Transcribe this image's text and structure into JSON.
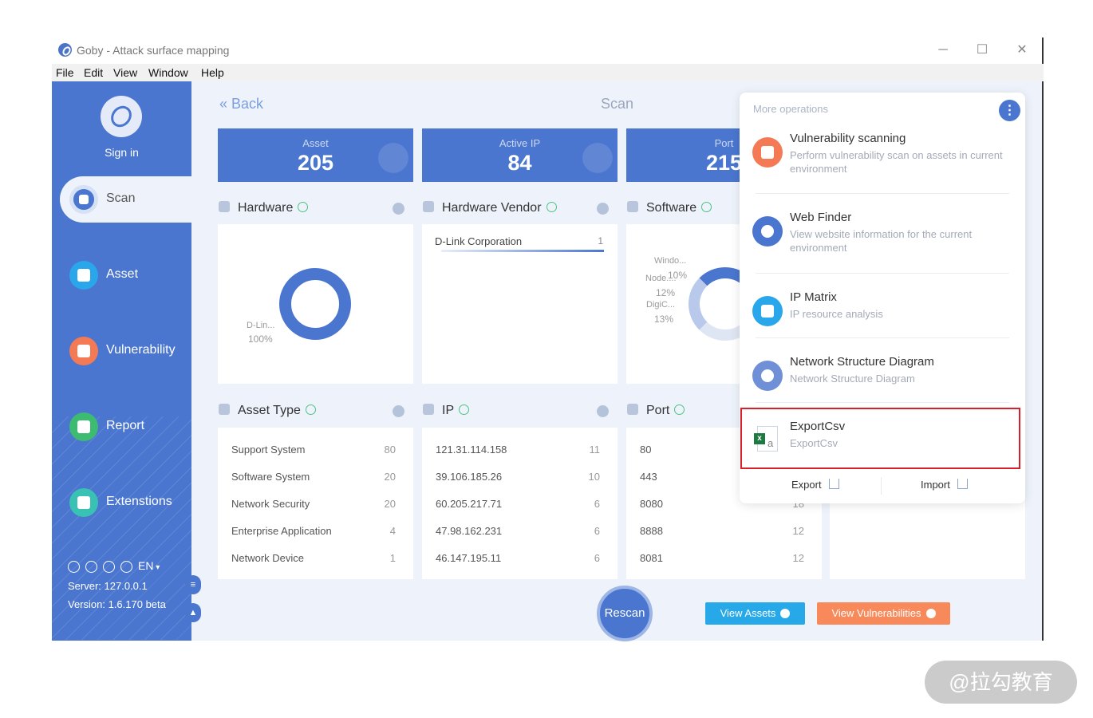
{
  "window": {
    "title": "Goby - Attack surface mapping",
    "controls": {
      "minimize": "─",
      "maximize": "☐",
      "close": "✕"
    }
  },
  "menu": [
    "File",
    "Edit",
    "View",
    "Window",
    "Help"
  ],
  "sidebar": {
    "sign_in": "Sign in",
    "items": [
      {
        "label": "Scan",
        "icon": "scan-icon",
        "color": "#4a76cf"
      },
      {
        "label": "Asset",
        "icon": "asset-icon",
        "color": "#29a7ea"
      },
      {
        "label": "Vulnerability",
        "icon": "bug-icon",
        "color": "#f47a55"
      },
      {
        "label": "Report",
        "icon": "report-icon",
        "color": "#3dbb70"
      },
      {
        "label": "Extenstions",
        "icon": "extension-icon",
        "color": "#39c1b4"
      }
    ],
    "lang": "EN",
    "server": "Server: 127.0.0.1",
    "version": "Version: 1.6.170 beta"
  },
  "header": {
    "back": "Back",
    "title": "Scan"
  },
  "stats": [
    {
      "label": "Asset",
      "value": "205"
    },
    {
      "label": "Active IP",
      "value": "84"
    },
    {
      "label": "Port",
      "value": "215"
    }
  ],
  "sections": {
    "hardware": {
      "title": "Hardware",
      "donut_label": "D-Lin...",
      "donut_percent": "100%"
    },
    "vendor": {
      "title": "Hardware Vendor",
      "items": [
        {
          "name": "D-Link Corporation",
          "count": "1"
        }
      ]
    },
    "software": {
      "title": "Software",
      "labels": [
        "Windo...",
        "Node....",
        "10%",
        "12%",
        "DigiC...",
        "13%"
      ]
    },
    "asset_type": {
      "title": "Asset Type",
      "rows": [
        {
          "name": "Support System",
          "count": "80"
        },
        {
          "name": "Software System",
          "count": "20"
        },
        {
          "name": "Network Security",
          "count": "20"
        },
        {
          "name": "Enterprise Application",
          "count": "4"
        },
        {
          "name": "Network Device",
          "count": "1"
        }
      ]
    },
    "ip": {
      "title": "IP",
      "rows": [
        {
          "name": "121.31.114.158",
          "count": "11"
        },
        {
          "name": "39.106.185.26",
          "count": "10"
        },
        {
          "name": "60.205.217.71",
          "count": "6"
        },
        {
          "name": "47.98.162.231",
          "count": "6"
        },
        {
          "name": "46.147.195.11",
          "count": "6"
        }
      ]
    },
    "port": {
      "title": "Port",
      "rows": [
        {
          "name": "80",
          "count": ""
        },
        {
          "name": "443",
          "count": ""
        },
        {
          "name": "8080",
          "count": "18"
        },
        {
          "name": "8888",
          "count": "12"
        },
        {
          "name": "8081",
          "count": "12"
        }
      ]
    }
  },
  "actions": {
    "rescan": "Rescan",
    "view_assets": "View Assets",
    "view_vulnerabilities": "View Vulnerabilities"
  },
  "popup": {
    "title": "More operations",
    "more_icon": "⋮",
    "operations": [
      {
        "title": "Vulnerability scanning",
        "desc": "Perform vulnerability scan on assets in current environment",
        "color": "#f47a55"
      },
      {
        "title": "Web Finder",
        "desc": "View website information for the current environment",
        "color": "#4a76cf"
      },
      {
        "title": "IP Matrix",
        "desc": "IP resource analysis",
        "color": "#29a7ea"
      },
      {
        "title": "Network Structure Diagram",
        "desc": "Network Structure Diagram",
        "color": "#6f8fd6"
      },
      {
        "title": "ExportCsv",
        "desc": "ExportCsv",
        "icon_x": "x",
        "icon_a": "a"
      }
    ],
    "export": "Export",
    "import": "Import"
  },
  "watermark": "@拉勾教育"
}
